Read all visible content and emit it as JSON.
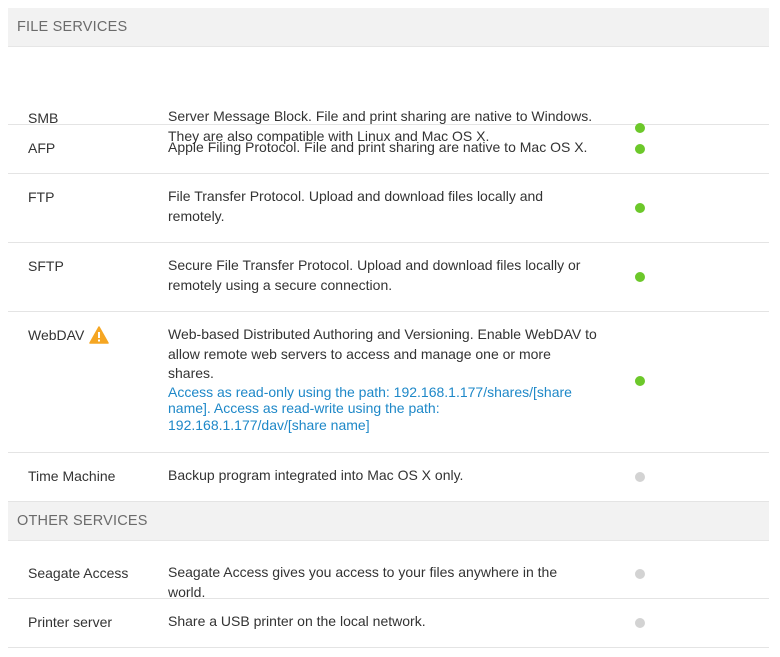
{
  "file_services": {
    "header": "FILE SERVICES",
    "items": [
      {
        "name": "SMB",
        "description": "Server Message Block. File and print sharing are native to Windows. They are also compatible with Linux and Mac OS X.",
        "status": "enabled"
      },
      {
        "name": "AFP",
        "description": "Apple Filing Protocol. File and print sharing are native to Mac OS X.",
        "status": "enabled"
      },
      {
        "name": "FTP",
        "description": "File Transfer Protocol. Upload and download files locally and remotely.",
        "status": "enabled"
      },
      {
        "name": "SFTP",
        "description": "Secure File Transfer Protocol. Upload and download files locally or remotely using a secure connection.",
        "status": "enabled"
      },
      {
        "name": "WebDAV",
        "description": "Web-based Distributed Authoring and Versioning. Enable WebDAV to allow remote web servers to access and manage one or more shares.",
        "link": "Access as read-only using the path: 192.168.1.177/shares/[share name]. Access as read-write using the path: 192.168.1.177/dav/[share name]",
        "warning_icon": "warning-icon",
        "status": "enabled"
      },
      {
        "name": "Time Machine",
        "description": "Backup program integrated into Mac OS X only.",
        "status": "disabled"
      }
    ]
  },
  "other_services": {
    "header": "OTHER SERVICES",
    "items": [
      {
        "name": "Seagate Access",
        "description": "Seagate Access gives you access to your files anywhere in the world.",
        "status": "disabled"
      },
      {
        "name": "Printer server",
        "description": "Share a USB printer on the local network.",
        "status": "disabled"
      }
    ]
  },
  "colors": {
    "enabled": "#6cc82a",
    "disabled": "#d3d3d3",
    "link": "#1e88c8",
    "warning": "#f5a623"
  }
}
